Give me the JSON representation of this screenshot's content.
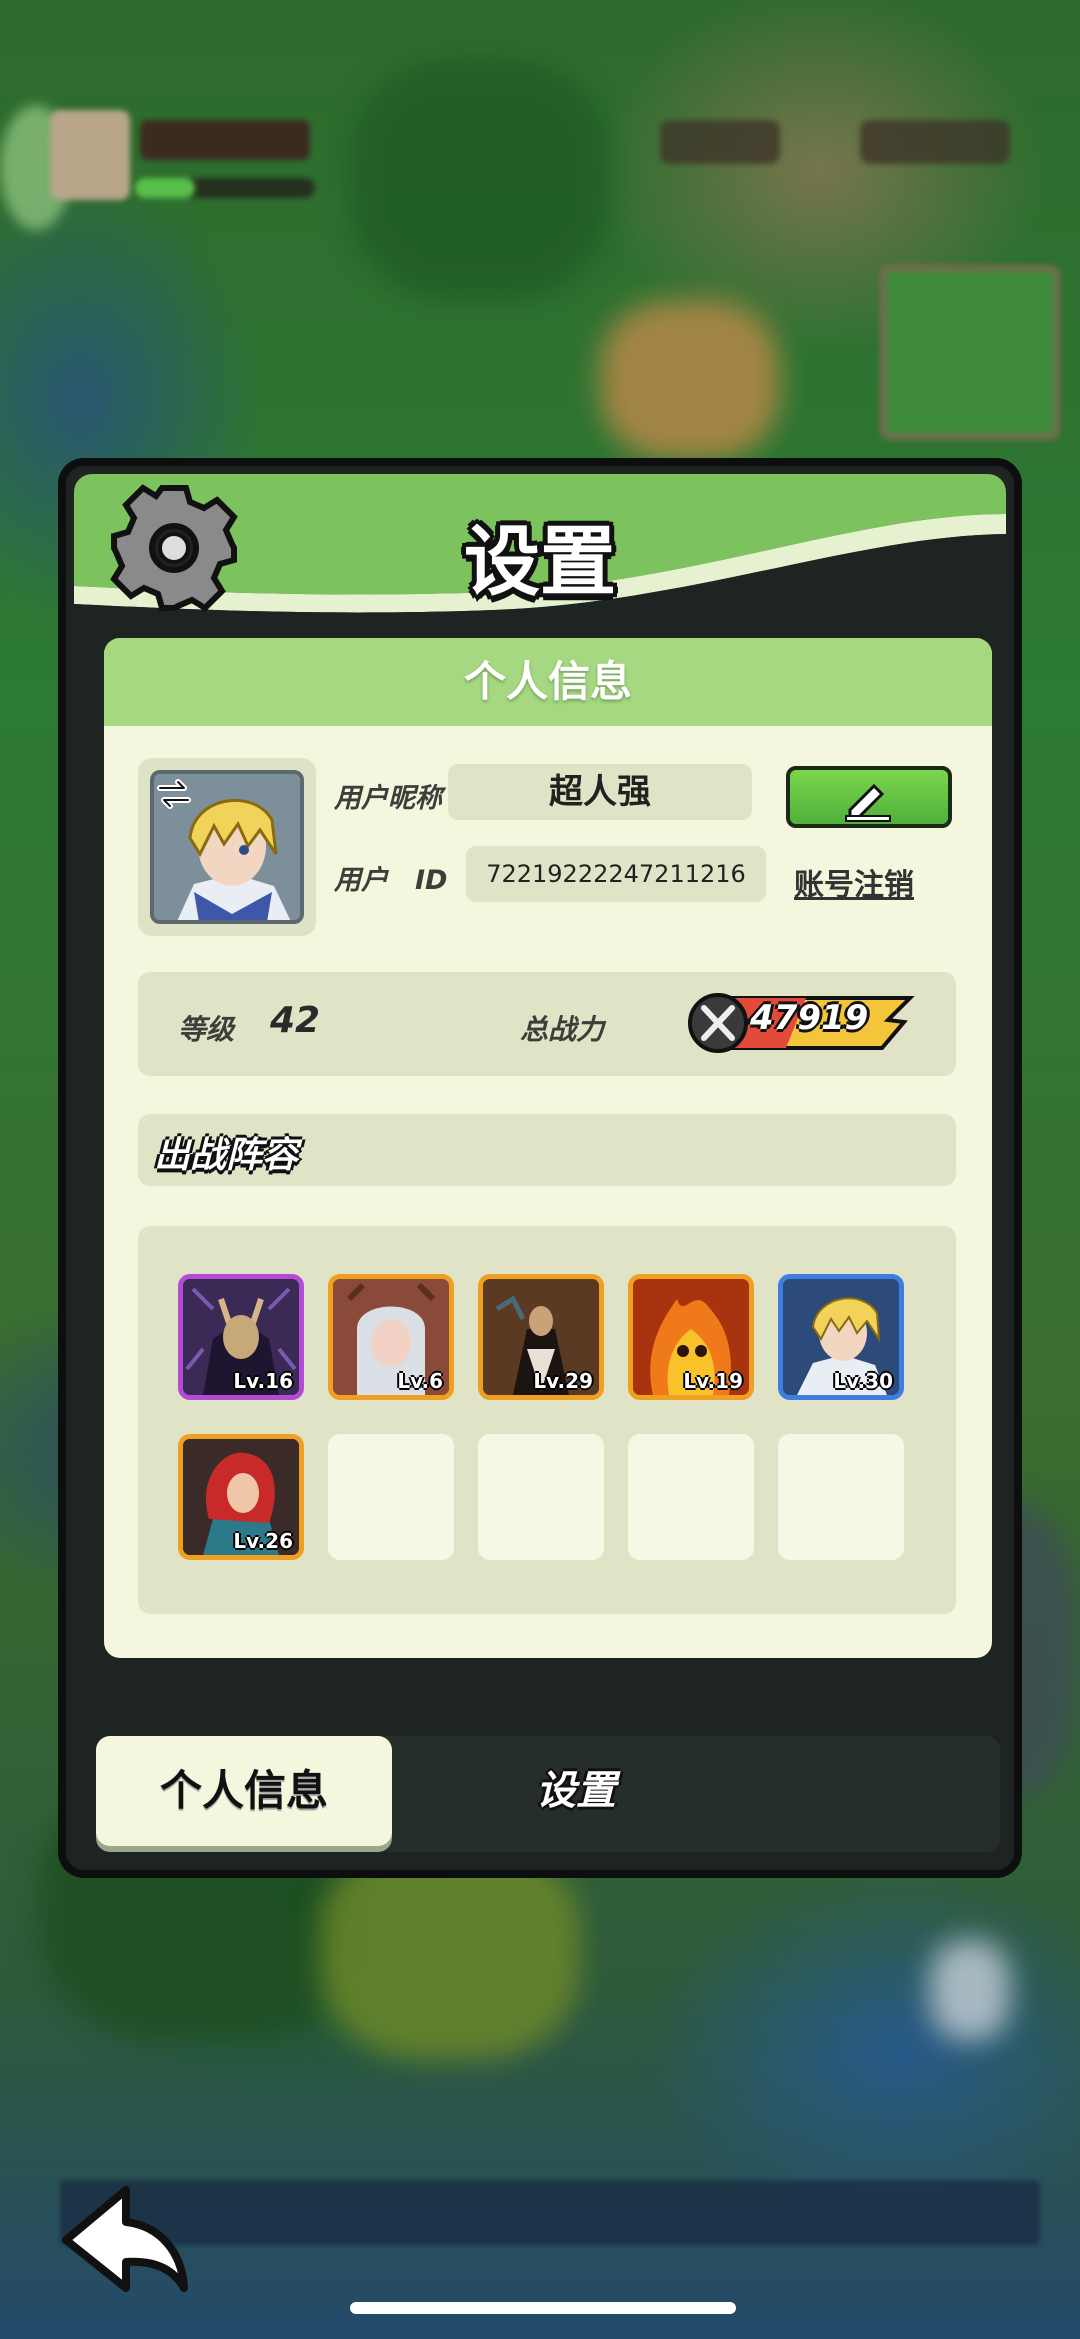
{
  "dialog": {
    "title": "设置",
    "panel_title": "个人信息"
  },
  "profile": {
    "nickname_label": "用户昵称",
    "nickname": "超人强",
    "id_label": "用户　ID",
    "user_id": "72219222247211216",
    "cancel_account": "账号注销",
    "level_label": "等级",
    "level": "42",
    "power_label": "总战力",
    "power": "47919"
  },
  "lineup": {
    "title": "出战阵容",
    "heroes": [
      {
        "level": "Lv.16",
        "frame": "purple",
        "color": "#b44bd6"
      },
      {
        "level": "Lv.6",
        "frame": "orange",
        "color": "#f0a020"
      },
      {
        "level": "Lv.29",
        "frame": "orange",
        "color": "#f0a020"
      },
      {
        "level": "Lv.19",
        "frame": "orange",
        "color": "#f0a020"
      },
      {
        "level": "Lv.30",
        "frame": "blue",
        "color": "#3f7de0"
      },
      {
        "level": "Lv.26",
        "frame": "orange",
        "color": "#f0a020"
      }
    ],
    "empty_slots": 4
  },
  "tabs": {
    "active": "个人信息",
    "settings": "设置"
  },
  "colors": {
    "header_green": "#a6d882",
    "panel_bg": "#f4f7dd",
    "edit_button": "#5fc13e",
    "power_gold": "#f4c53a"
  },
  "icons": {
    "gear": "gear-icon",
    "edit": "pencil-icon",
    "switch": "swap-arrow-icon",
    "power": "crossed-swords-icon",
    "back": "back-arrow-icon"
  }
}
